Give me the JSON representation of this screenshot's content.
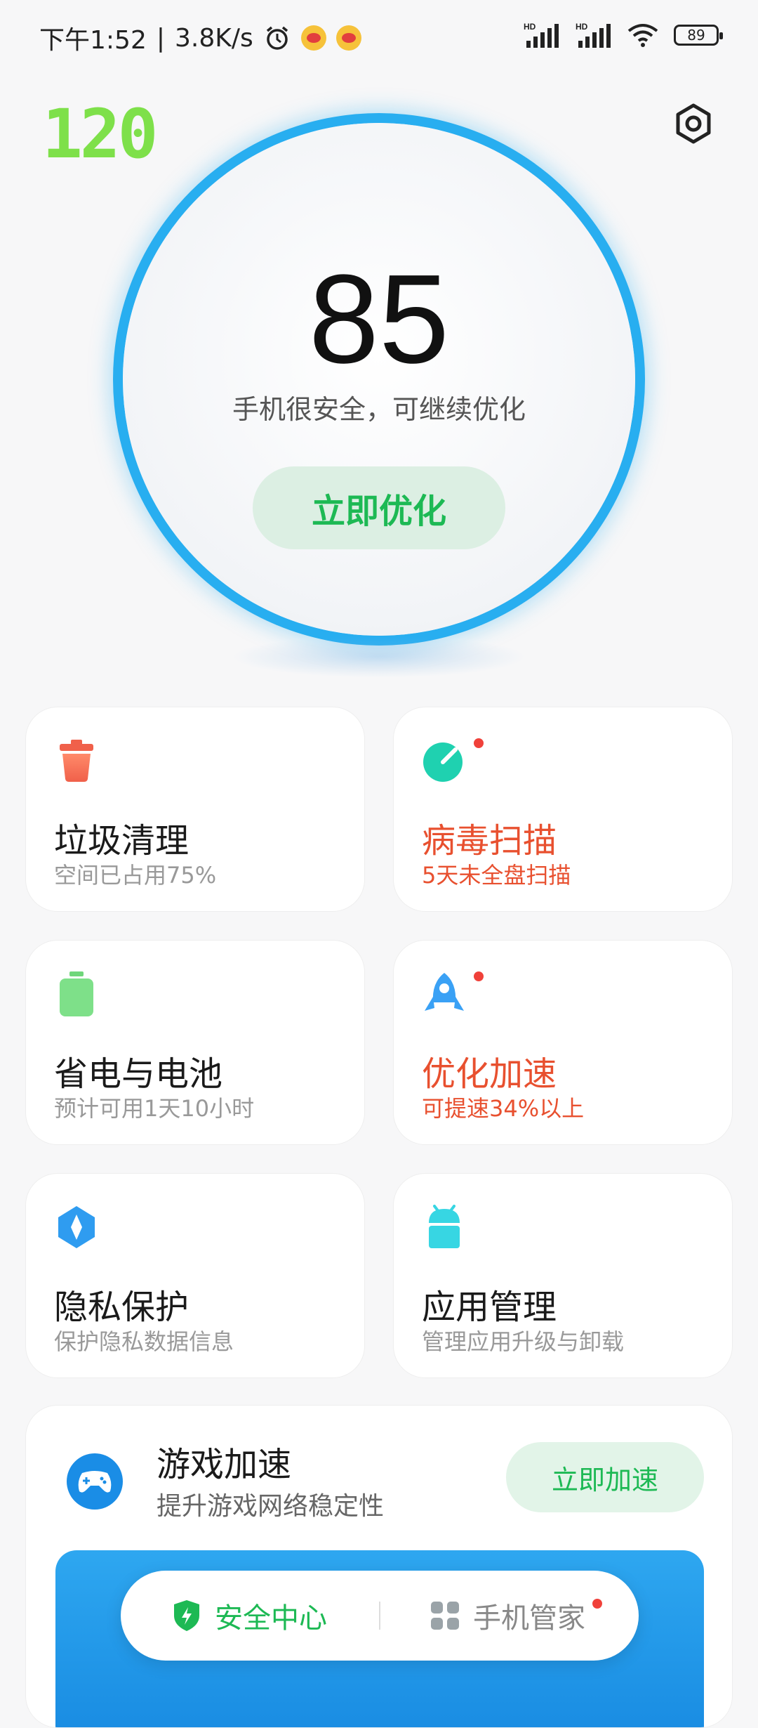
{
  "status_bar": {
    "time": "下午1:52",
    "speed": "3.8K/s",
    "battery": "89"
  },
  "header": {
    "badge": "120"
  },
  "score": {
    "value": "85",
    "subtitle": "手机很安全，可继续优化",
    "button": "立即优化"
  },
  "cards": [
    {
      "title": "垃圾清理",
      "subtitle": "空间已占用75%"
    },
    {
      "title": "病毒扫描",
      "subtitle": "5天未全盘扫描"
    },
    {
      "title": "省电与电池",
      "subtitle": "预计可用1天10小时"
    },
    {
      "title": "优化加速",
      "subtitle": "可提速34%以上"
    },
    {
      "title": "隐私保护",
      "subtitle": "保护隐私数据信息"
    },
    {
      "title": "应用管理",
      "subtitle": "管理应用升级与卸载"
    }
  ],
  "game": {
    "title": "游戏加速",
    "subtitle": "提升游戏网络稳定性",
    "button": "立即加速"
  },
  "nav": {
    "tab_security": "安全中心",
    "tab_manager": "手机管家"
  },
  "colors": {
    "accent_green": "#1db954",
    "ring_blue": "#28aef0",
    "alert_orange": "#e8502f",
    "badge_green": "#7ee04a"
  },
  "icons": [
    "alarm-icon",
    "weibo-icon",
    "hd-signal-icon",
    "wifi-icon",
    "battery-icon",
    "settings-hex-icon",
    "trash-icon",
    "virus-scan-icon",
    "battery-saver-icon",
    "rocket-icon",
    "privacy-shield-icon",
    "android-icon",
    "gamepad-icon",
    "shield-bolt-icon",
    "grid-apps-icon"
  ]
}
